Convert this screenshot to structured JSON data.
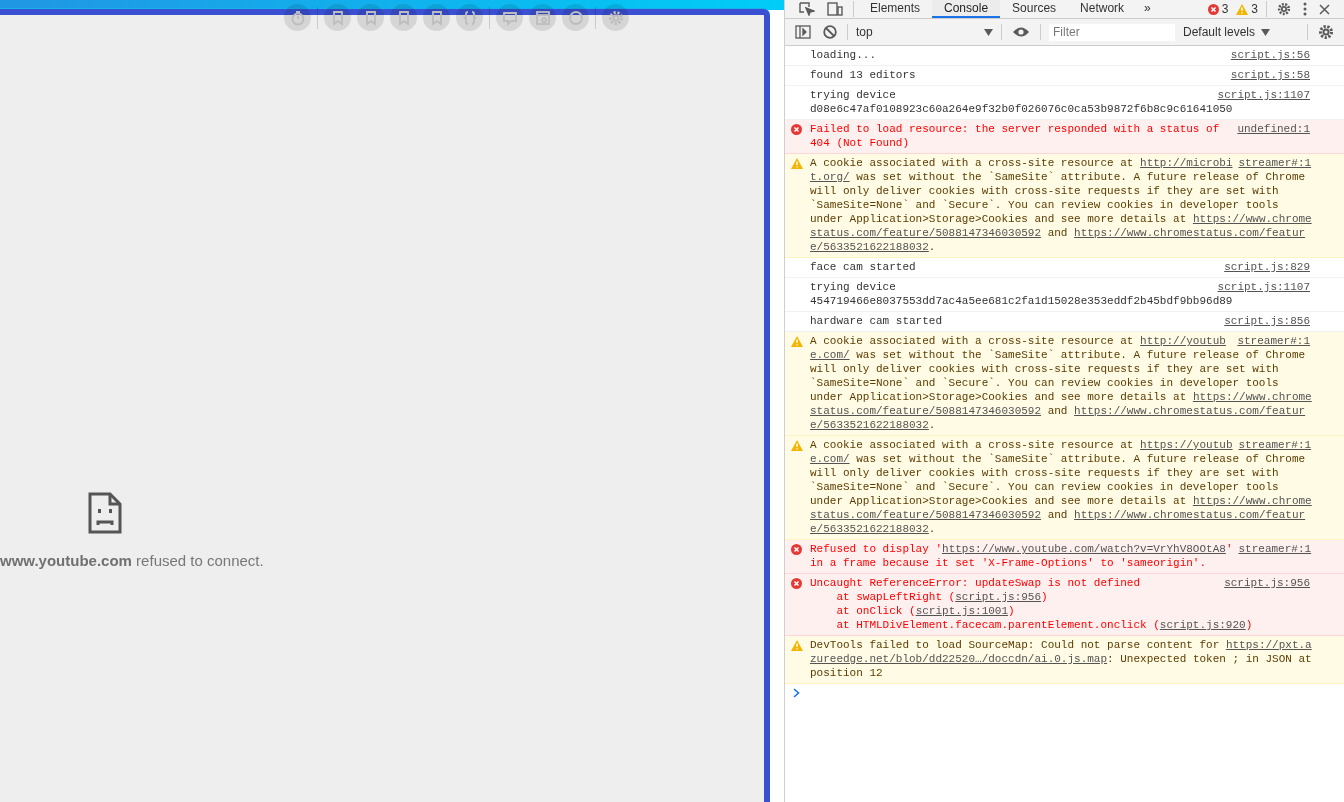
{
  "page": {
    "host": "www.youtube.com",
    "message": " refused to connect."
  },
  "devtools": {
    "tabs": [
      {
        "label": "Elements",
        "selected": false
      },
      {
        "label": "Console",
        "selected": true
      },
      {
        "label": "Sources",
        "selected": false
      },
      {
        "label": "Network",
        "selected": false
      }
    ],
    "more_tabs": "»",
    "errors": "3",
    "warnings": "3",
    "context": "top",
    "filter": {
      "placeholder": "Filter"
    },
    "levels": "Default levels",
    "messages": [
      {
        "kind": "info",
        "source": "script.js:56",
        "lines": [
          [
            "loading..."
          ]
        ]
      },
      {
        "kind": "info",
        "source": "script.js:58",
        "lines": [
          [
            "found 13 editors"
          ]
        ]
      },
      {
        "kind": "info",
        "source": "script.js:1107",
        "lines": [
          [
            "trying device"
          ],
          [
            "d08e6c47af0108923c60a264e9f32b0f026076c0ca53b9872f6b8c9c61641050"
          ]
        ]
      },
      {
        "kind": "error",
        "source": "undefined:1",
        "lines": [
          [
            "Failed to load resource: the server responded with a status of"
          ],
          [
            "404 (Not Found)"
          ]
        ]
      },
      {
        "kind": "warn",
        "source": "streamer#:1",
        "lines": [
          [
            "A cookie associated with a cross-site resource at ",
            {
              "link": "http://microbi"
            }
          ],
          [
            {
              "link": "t.org/"
            },
            " was set without the `SameSite` attribute. A future release of Chrome"
          ],
          [
            "will only deliver cookies with cross-site requests if they are set with"
          ],
          [
            "`SameSite=None` and `Secure`. You can review cookies in developer tools"
          ],
          [
            "under Application>Storage>Cookies and see more details at ",
            {
              "link": "https://www.chrome"
            }
          ],
          [
            {
              "link": "status.com/feature/5088147346030592"
            },
            " and ",
            {
              "link": "https://www.chromestatus.com/featur"
            }
          ],
          [
            {
              "link": "e/5633521622188032"
            },
            "."
          ]
        ]
      },
      {
        "kind": "info",
        "source": "script.js:829",
        "lines": [
          [
            "face cam started"
          ]
        ]
      },
      {
        "kind": "info",
        "source": "script.js:1107",
        "lines": [
          [
            "trying device"
          ],
          [
            "454719466e8037553dd7ac4a5ee681c2fa1d15028e353eddf2b45bdf9bb96d89"
          ]
        ]
      },
      {
        "kind": "info",
        "source": "script.js:856",
        "lines": [
          [
            "hardware cam started"
          ]
        ]
      },
      {
        "kind": "warn",
        "source": "streamer#:1",
        "lines": [
          [
            "A cookie associated with a cross-site resource at ",
            {
              "link": "http://youtub"
            }
          ],
          [
            {
              "link": "e.com/"
            },
            " was set without the `SameSite` attribute. A future release of Chrome"
          ],
          [
            "will only deliver cookies with cross-site requests if they are set with"
          ],
          [
            "`SameSite=None` and `Secure`. You can review cookies in developer tools"
          ],
          [
            "under Application>Storage>Cookies and see more details at ",
            {
              "link": "https://www.chrome"
            }
          ],
          [
            {
              "link": "status.com/feature/5088147346030592"
            },
            " and ",
            {
              "link": "https://www.chromestatus.com/featur"
            }
          ],
          [
            {
              "link": "e/5633521622188032"
            },
            "."
          ]
        ]
      },
      {
        "kind": "warn",
        "source": "streamer#:1",
        "lines": [
          [
            "A cookie associated with a cross-site resource at ",
            {
              "link": "https://youtub"
            }
          ],
          [
            {
              "link": "e.com/"
            },
            " was set without the `SameSite` attribute. A future release of Chrome"
          ],
          [
            "will only deliver cookies with cross-site requests if they are set with"
          ],
          [
            "`SameSite=None` and `Secure`. You can review cookies in developer tools"
          ],
          [
            "under Application>Storage>Cookies and see more details at ",
            {
              "link": "https://www.chrome"
            }
          ],
          [
            {
              "link": "status.com/feature/5088147346030592"
            },
            " and ",
            {
              "link": "https://www.chromestatus.com/featur"
            }
          ],
          [
            {
              "link": "e/5633521622188032"
            },
            "."
          ]
        ]
      },
      {
        "kind": "error",
        "source": "streamer#:1",
        "lines": [
          [
            "Refused to display '",
            {
              "link": "https://www.youtube.com/watch?v=VrYhV8OOtA8"
            },
            "'"
          ],
          [
            "in a frame because it set 'X-Frame-Options' to 'sameorigin'."
          ]
        ]
      },
      {
        "kind": "error",
        "source": "script.js:956",
        "lines": [
          [
            "Uncaught ReferenceError: updateSwap is not defined"
          ],
          [
            "    at swapLeftRight (",
            {
              "link": "script.js:956"
            },
            ")"
          ],
          [
            "    at onClick (",
            {
              "link": "script.js:1001"
            },
            ")"
          ],
          [
            "    at HTMLDivElement.facecam.parentElement.onclick (",
            {
              "link": "script.js:920"
            },
            ")"
          ]
        ]
      },
      {
        "kind": "warn",
        "lines": [
          [
            "DevTools failed to load SourceMap: Could not parse content for ",
            {
              "link": "https://pxt.a"
            }
          ],
          [
            {
              "link": "zureedge.net/blob/dd22520…/doccdn/ai.0.js.map"
            },
            ": Unexpected token ; in JSON at"
          ],
          [
            "position 12"
          ]
        ]
      }
    ]
  }
}
